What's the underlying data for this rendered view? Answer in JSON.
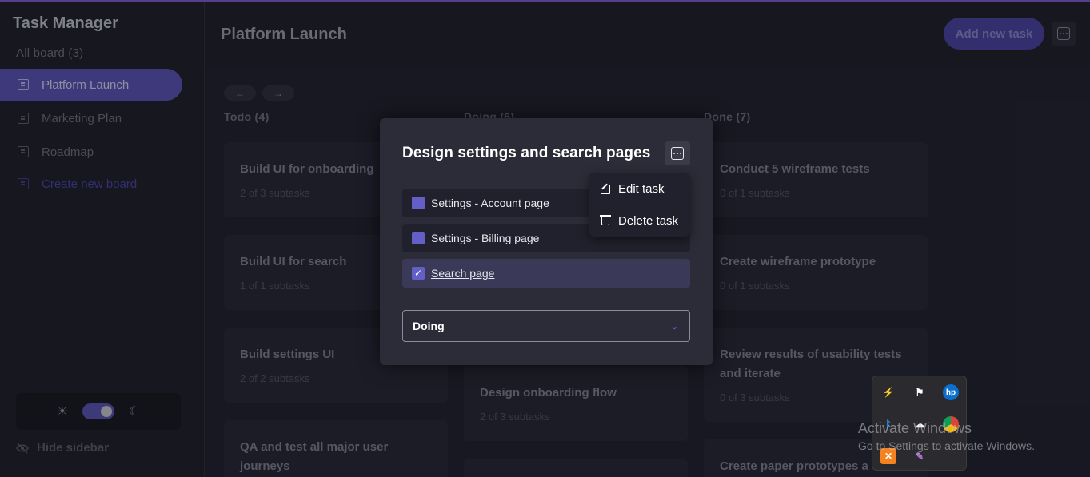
{
  "app": {
    "title": "Task Manager",
    "accent": "#635fc7"
  },
  "sidebar": {
    "all_boards": "All board (3)",
    "boards": [
      {
        "label": "Platform Launch",
        "active": true
      },
      {
        "label": "Marketing Plan",
        "active": false
      },
      {
        "label": "Roadmap",
        "active": false
      }
    ],
    "create_board": "Create new board",
    "theme_light_icon": "☀",
    "theme_dark_icon": "☾",
    "hide_sidebar": "Hide sidebar"
  },
  "header": {
    "board_title": "Platform Launch",
    "add_task": "Add new task"
  },
  "nav": {
    "prev": "←",
    "next": "→"
  },
  "columns": [
    {
      "heading": "Todo (4)",
      "cards": [
        {
          "title": "Build UI for onboarding",
          "subtasks": "2 of 3 subtasks"
        },
        {
          "title": "Build UI for search",
          "subtasks": "1 of 1 subtasks"
        },
        {
          "title": "Build settings UI",
          "subtasks": "2 of 2 subtasks"
        },
        {
          "title": "QA and test all major user journeys",
          "subtasks": ""
        }
      ]
    },
    {
      "heading": "Doing (6)",
      "cards": [
        {
          "title": "Design onboarding flow",
          "subtasks": "2 of 3 subtasks"
        }
      ]
    },
    {
      "heading": "Done (7)",
      "cards": [
        {
          "title": "Conduct 5 wireframe tests",
          "subtasks": "0 of 1 subtasks"
        },
        {
          "title": "Create wireframe prototype",
          "subtasks": "0 of 1 subtasks"
        },
        {
          "title": "Review results of usability tests and iterate",
          "subtasks": "0 of 3 subtasks"
        },
        {
          "title": "Create paper prototypes a",
          "subtasks": ""
        }
      ]
    }
  ],
  "modal": {
    "title": "Design settings and search pages",
    "subtasks": [
      {
        "label": "Settings - Account page",
        "checked": false
      },
      {
        "label": "Settings - Billing page",
        "checked": false
      },
      {
        "label": "Search page",
        "checked": true
      }
    ],
    "status": "Doing",
    "menu": {
      "edit": "Edit task",
      "delete": "Delete task"
    }
  },
  "system": {
    "activate_title": "Activate Windows",
    "activate_sub": "Go to Settings to activate Windows.",
    "tray_icons": [
      "usb-icon",
      "flag-icon",
      "hp-icon",
      "bluetooth-icon",
      "cloud-icon",
      "chrome-icon",
      "xampp-icon",
      "feather-icon"
    ],
    "hp_label": "hp",
    "check_mark": "✓"
  }
}
